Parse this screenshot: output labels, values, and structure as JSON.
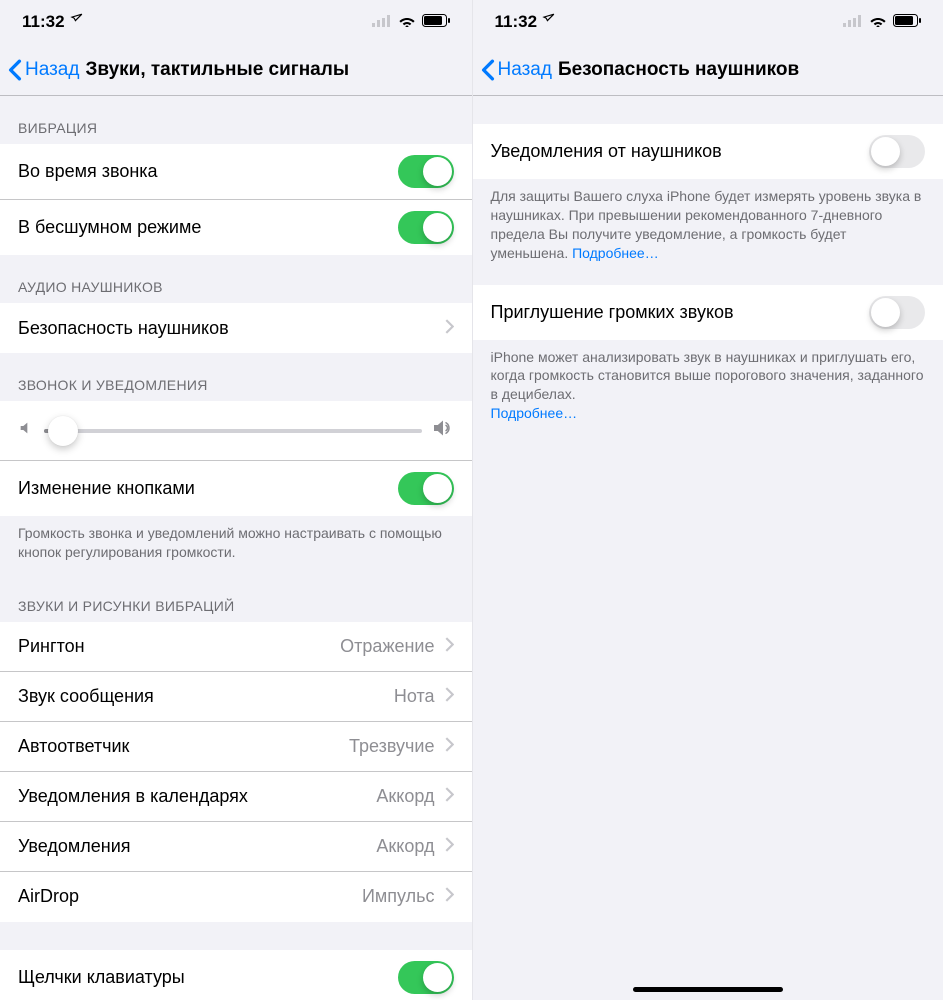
{
  "status": {
    "time": "11:32"
  },
  "left": {
    "back": "Назад",
    "title": "Звуки, тактильные сигналы",
    "sections": {
      "vibration": {
        "header": "ВИБРАЦИЯ",
        "ring": "Во время звонка",
        "silent": "В бесшумном режиме"
      },
      "headphoneAudio": {
        "header": "АУДИО НАУШНИКОВ",
        "safety": "Безопасность наушников"
      },
      "ringer": {
        "header": "ЗВОНОК И УВЕДОМЛЕНИЯ",
        "changeButtons": "Изменение кнопками",
        "footer": "Громкость звонка и уведомлений можно настраивать с помощью кнопок регулирования громкости."
      },
      "sounds": {
        "header": "ЗВУКИ И РИСУНКИ ВИБРАЦИЙ",
        "items": [
          {
            "label": "Рингтон",
            "value": "Отражение"
          },
          {
            "label": "Звук сообщения",
            "value": "Нота"
          },
          {
            "label": "Автоответчик",
            "value": "Трезвучие"
          },
          {
            "label": "Уведомления в календарях",
            "value": "Аккорд"
          },
          {
            "label": "Уведомления",
            "value": "Аккорд"
          },
          {
            "label": "AirDrop",
            "value": "Импульс"
          }
        ]
      },
      "keyboard": {
        "clicks": "Щелчки клавиатуры"
      }
    },
    "slider": {
      "value": 5
    }
  },
  "right": {
    "back": "Назад",
    "title": "Безопасность наушников",
    "rows": {
      "notif": "Уведомления от наушников",
      "reduce": "Приглушение громких звуков"
    },
    "footers": {
      "notif_a": "Для защиты Вашего слуха iPhone будет измерять уровень звука в наушниках. При превышении рекомендованного 7-дневного предела Вы получите уведомление, а громкость будет уменьшена. ",
      "notif_link": "Подробнее…",
      "reduce_a": "iPhone может анализировать звук в наушниках и приглушать его, когда громкость становится выше порогового значения, заданного в децибелах.",
      "reduce_link": "Подробнее…"
    }
  }
}
